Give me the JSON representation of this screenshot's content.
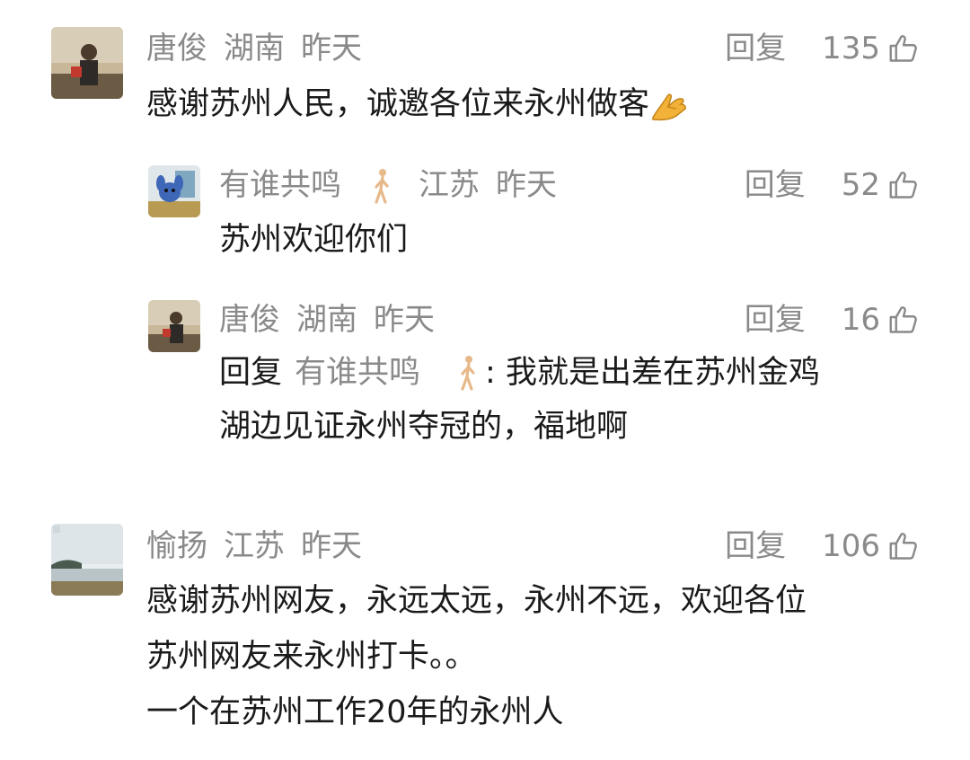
{
  "comments": [
    {
      "user": "唐俊",
      "location": "湖南",
      "time": "昨天",
      "reply_label": "回复",
      "likes": "135",
      "avatar_icon": "person-portrait-avatar",
      "text": "感谢苏州人民，诚邀各位来永州做客",
      "emoji_icon": "folded-hands-icon",
      "replies": [
        {
          "user": "有谁共鸣",
          "user_badge_icon": "walking-person-icon",
          "location": "江苏",
          "time": "昨天",
          "reply_label": "回复",
          "likes": "52",
          "avatar_icon": "cartoon-avatar",
          "text": "苏州欢迎你们"
        },
        {
          "user": "唐俊",
          "location": "湖南",
          "time": "昨天",
          "reply_label": "回复",
          "likes": "16",
          "avatar_icon": "person-portrait-avatar",
          "reply_prefix": "回复",
          "reply_to": "有谁共鸣",
          "reply_to_badge_icon": "walking-person-icon",
          "text_line1": ":  我就是出差在苏州金鸡",
          "text_line2": "湖边见证永州夺冠的，福地啊"
        }
      ]
    },
    {
      "user": "愉扬",
      "location": "江苏",
      "time": "昨天",
      "reply_label": "回复",
      "likes": "106",
      "avatar_icon": "landscape-avatar",
      "text_line1": "感谢苏州网友，永远太远，永州不远，欢迎各位",
      "text_line2": "苏州网友来永州打卡。。",
      "text_line3": "一个在苏州工作20年的永州人"
    }
  ],
  "colors": {
    "meta_gray": "#8a8a8a",
    "text_dark": "#1a1a1a",
    "background": "#ffffff"
  }
}
